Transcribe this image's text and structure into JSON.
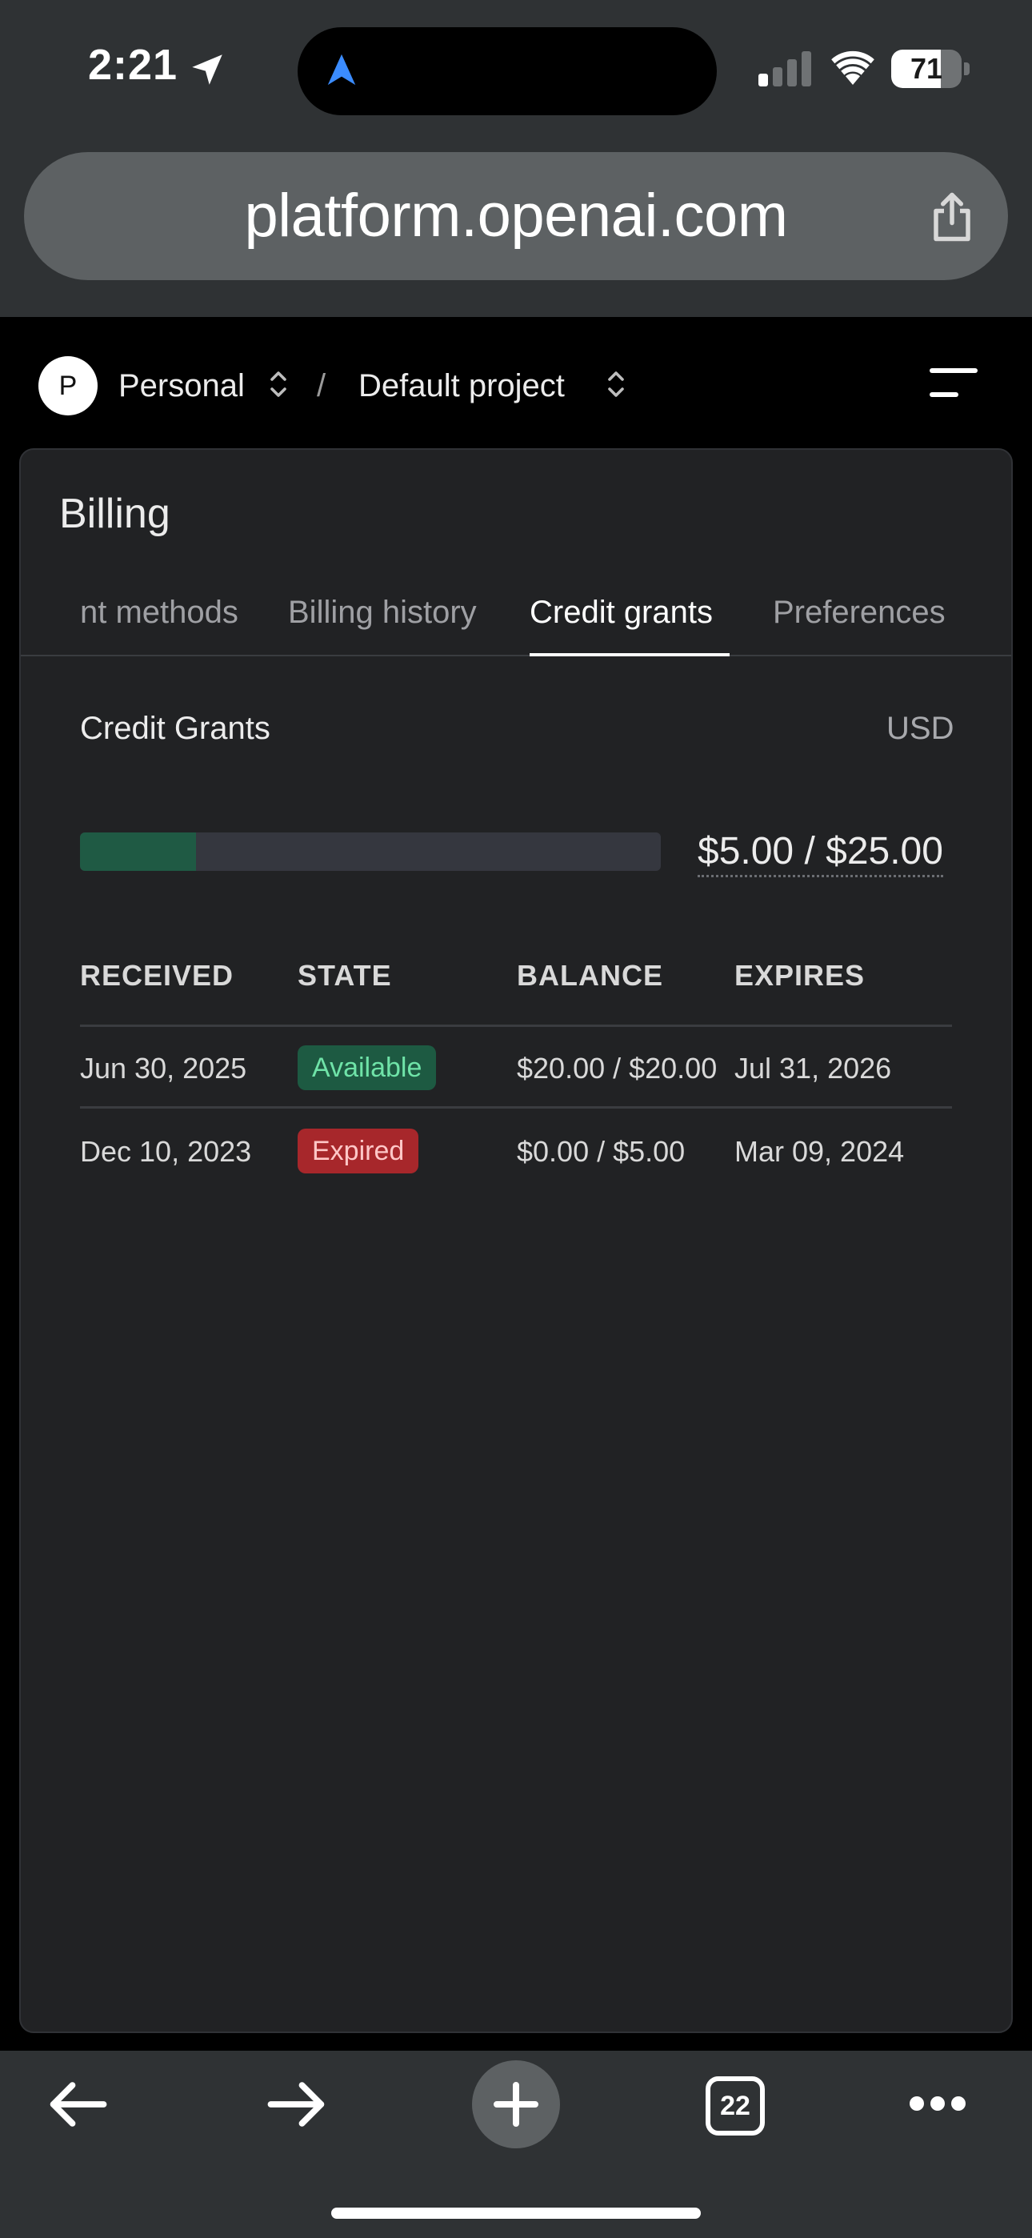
{
  "status_bar": {
    "time": "2:21",
    "battery_level": "71",
    "battery_fraction": 0.71
  },
  "browser": {
    "url": "platform.openai.com",
    "open_tabs_count": "22"
  },
  "header": {
    "avatar_letter": "P",
    "organization": "Personal",
    "separator": "/",
    "project": "Default project"
  },
  "billing": {
    "title": "Billing",
    "tabs": [
      {
        "label": "nt methods"
      },
      {
        "label": "Billing history"
      },
      {
        "label": "Credit grants",
        "active": true
      },
      {
        "label": "Preferences"
      }
    ],
    "section_title": "Credit Grants",
    "currency": "USD",
    "usage": {
      "amount_label": "$5.00 / $25.00",
      "used": 5.0,
      "total": 25.0
    },
    "table": {
      "columns": [
        "RECEIVED",
        "STATE",
        "BALANCE",
        "EXPIRES"
      ],
      "rows": [
        {
          "received": "Jun 30, 2025",
          "state": "Available",
          "balance": "$20.00 / $20.00",
          "expires": "Jul 31, 2026"
        },
        {
          "received": "Dec 10, 2023",
          "state": "Expired",
          "balance": "$0.00 / $5.00",
          "expires": "Mar 09, 2024"
        }
      ]
    }
  },
  "colors": {
    "accent_green": "#1f5a44",
    "available_badge": "#1d5a42",
    "expired_badge": "#a7272b",
    "card_bg": "#212224",
    "chrome_bg": "#2f3234"
  }
}
